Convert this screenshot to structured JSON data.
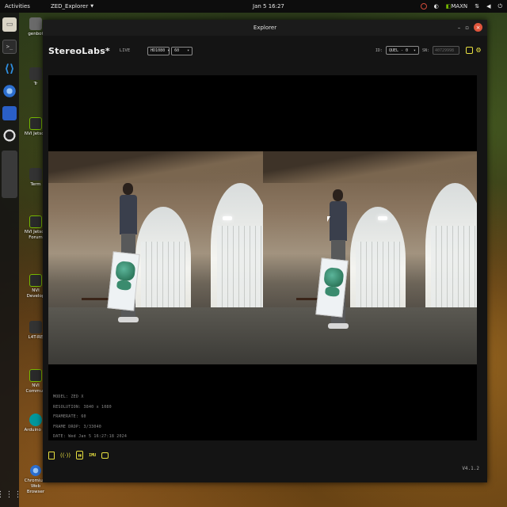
{
  "topbar": {
    "activities": "Activities",
    "app_menu": "ZED_Explorer",
    "clock": "Jan 5  16:27",
    "maxn_label": "MAXN"
  },
  "desktop_icons": [
    {
      "label": "genbot",
      "icon": "home-folder-icon"
    },
    {
      "label": "Tr",
      "icon": "folder-icon"
    },
    {
      "label": "NVI Jetson",
      "icon": "nvidia-icon"
    },
    {
      "label": "Term",
      "icon": "terminal-icon"
    },
    {
      "label": "NVI Jetson Forum",
      "icon": "nvidia-icon"
    },
    {
      "label": "NVI Develop",
      "icon": "nvidia-icon"
    },
    {
      "label": "L4T-RE",
      "icon": "document-icon"
    },
    {
      "label": "NVI Commun",
      "icon": "nvidia-icon"
    },
    {
      "label": "Arduino ID",
      "icon": "arduino-icon"
    },
    {
      "label": "Chromium Web Browser",
      "icon": "chromium-icon"
    }
  ],
  "window": {
    "title": "Explorer",
    "brand": "StereoLabs*",
    "live_label": "LIVE",
    "resolution_select": "HD1080",
    "fps_select": "60",
    "id_label": "ID:",
    "id_select": "QUEL - 0",
    "sn_label": "SN:",
    "sn_value": "40729998",
    "info": {
      "model": "MODEL: ZED X",
      "resolution": "RESOLUTION: 3840 x 1080",
      "framerate": "FRAMERATE: 60",
      "frame_drop": "FRAME DROP: 3/33040",
      "date": "DATE: Wed Jan 5 16:27:18 2024"
    },
    "version": "V4.1.2",
    "bottom_tools": {
      "imu_label": "IMU"
    }
  },
  "colors": {
    "accent_yellow": "#e8e040",
    "nvidia_green": "#76b900",
    "close_red": "#e0553c"
  }
}
